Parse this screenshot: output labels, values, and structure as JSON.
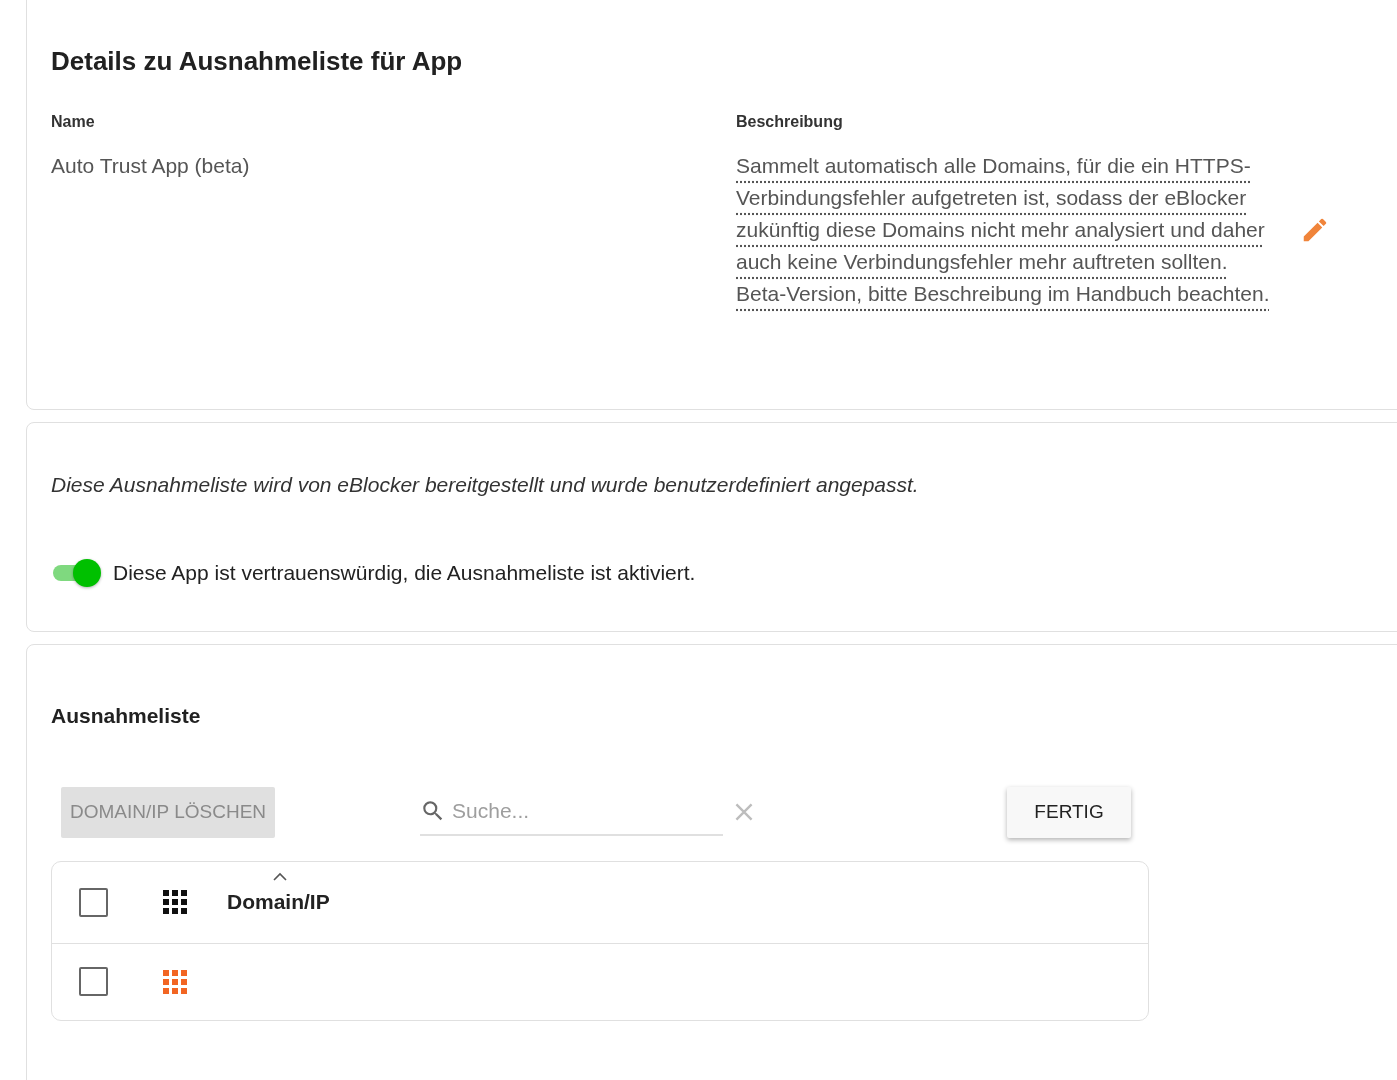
{
  "title": "Details zu Ausnahmeliste für App",
  "name": {
    "label": "Name",
    "value": "Auto Trust App (beta)"
  },
  "description": {
    "label": "Beschreibung",
    "value": "Sammelt automatisch alle Domains, für die ein HTTPS-Verbindungsfehler aufgetreten ist, sodass der eBlocker zukünftig diese Domains nicht mehr analysiert und daher auch keine Verbindungsfehler mehr auftreten sollten. Beta-Version, bitte Beschreibung im Handbuch beachten."
  },
  "notice": "Diese Ausnahmeliste wird von eBlocker bereitgestellt und wurde benutzerdefiniert angepasst.",
  "toggle": {
    "label": "Diese App ist vertrauenswürdig, die Ausnahmeliste ist aktiviert.",
    "on": true
  },
  "list": {
    "title": "Ausnahmeliste",
    "delete_button": {
      "label": "DOMAIN/IP LÖSCHEN",
      "disabled": true
    },
    "search": {
      "placeholder": "Suche..."
    },
    "done_button": {
      "label": "FERTIG"
    },
    "header": {
      "checked": false,
      "column": "Domain/IP",
      "sorted_ascending": true
    },
    "rows": [
      {
        "checked": false
      }
    ]
  }
}
